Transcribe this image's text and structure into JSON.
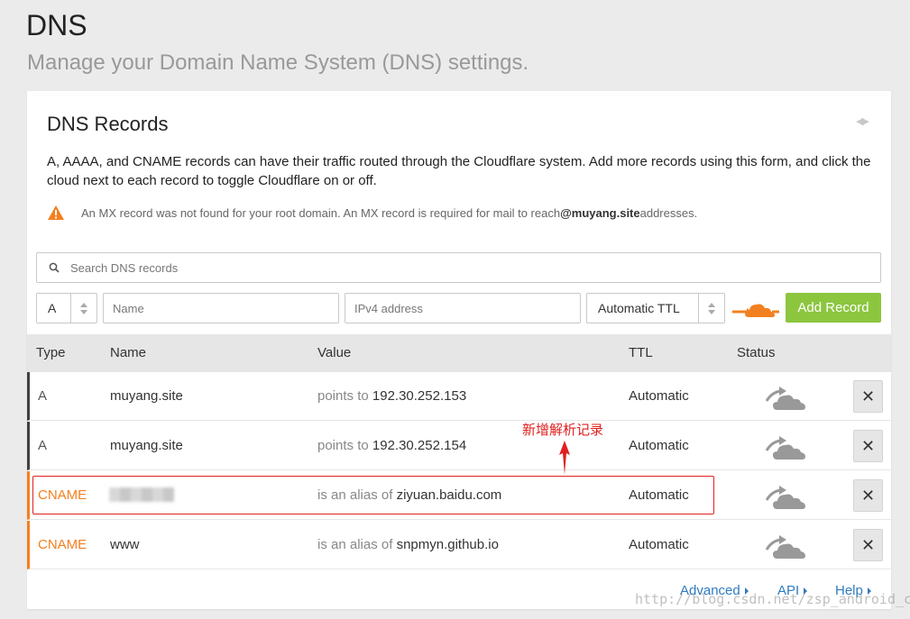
{
  "page": {
    "title": "DNS",
    "subtitle": "Manage your Domain Name System (DNS) settings."
  },
  "card": {
    "title": "DNS Records",
    "description": "A, AAAA, and CNAME records can have their traffic routed through the Cloudflare system. Add more records using this form, and click the cloud next to each record to toggle Cloudflare on or off.",
    "warning": {
      "before": "An MX record was not found for your root domain. An MX record is required for mail to reach ",
      "domain": "@muyang.site",
      "after": " addresses."
    }
  },
  "search": {
    "placeholder": "Search DNS records"
  },
  "form": {
    "type_value": "A",
    "name_placeholder": "Name",
    "value_placeholder": "IPv4 address",
    "ttl_value": "Automatic TTL",
    "add_label": "Add Record"
  },
  "table": {
    "headers": {
      "type": "Type",
      "name": "Name",
      "value": "Value",
      "ttl": "TTL",
      "status": "Status"
    },
    "rows": [
      {
        "type": "A",
        "name": "muyang.site",
        "value_prefix": "points to",
        "value": "192.30.252.153",
        "ttl": "Automatic",
        "delete_label": "✕"
      },
      {
        "type": "A",
        "name": "muyang.site",
        "value_prefix": "points to",
        "value": "192.30.252.154",
        "ttl": "Automatic",
        "delete_label": "✕"
      },
      {
        "type": "CNAME",
        "name": "",
        "value_prefix": "is an alias of",
        "value": "ziyuan.baidu.com",
        "ttl": "Automatic",
        "delete_label": "✕"
      },
      {
        "type": "CNAME",
        "name": "www",
        "value_prefix": "is an alias of",
        "value": "snpmyn.github.io",
        "ttl": "Automatic",
        "delete_label": "✕"
      }
    ]
  },
  "annotation": {
    "text": "新增解析记录"
  },
  "footer": {
    "advanced": "Advanced",
    "api": "API",
    "help": "Help"
  },
  "watermark": "http://blog.csdn.net/zsp_android_com",
  "colors": {
    "accent_orange": "#f38020",
    "add_green": "#8cc63f",
    "link_blue": "#2f7bbf",
    "annotation_red": "#e02020"
  }
}
